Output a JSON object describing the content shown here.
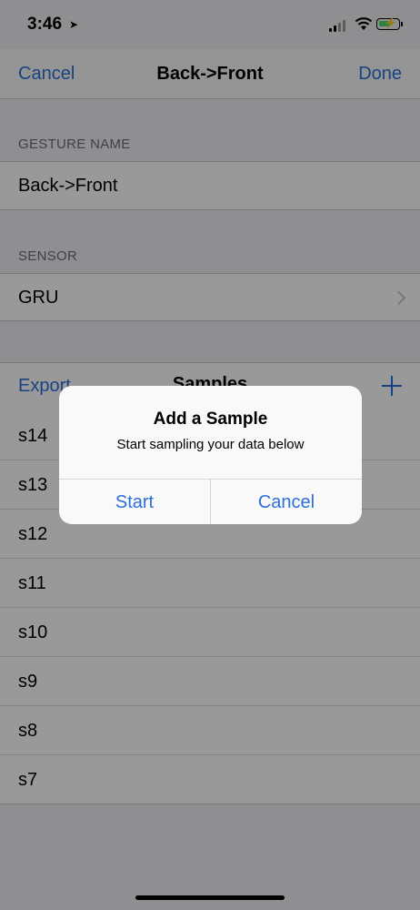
{
  "status_bar": {
    "time": "3:46",
    "location_icon": "location-arrow-icon",
    "battery_color": "#4cd964"
  },
  "nav": {
    "left": "Cancel",
    "title": "Back->Front",
    "right": "Done"
  },
  "gesture_section": {
    "header": "GESTURE NAME",
    "value": "Back->Front"
  },
  "sensor_section": {
    "header": "SENSOR",
    "value": "GRU"
  },
  "samples": {
    "export": "Export",
    "title": "Samples",
    "rows": [
      "s14",
      "s13",
      "s12",
      "s11",
      "s10",
      "s9",
      "s8",
      "s7"
    ]
  },
  "alert": {
    "title": "Add a Sample",
    "message": "Start sampling your data below",
    "start": "Start",
    "cancel": "Cancel"
  },
  "colors": {
    "accent": "#2b6fd9",
    "background": "#efeff4"
  }
}
